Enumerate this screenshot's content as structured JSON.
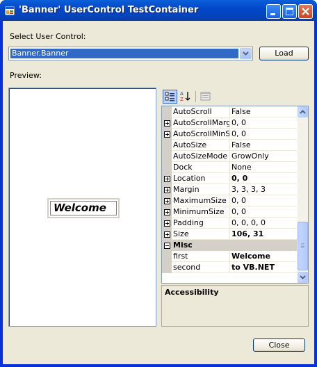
{
  "window": {
    "title": "'Banner' UserControl TestContainer"
  },
  "select_label": "Select User Control:",
  "combo_value": "Banner.Banner",
  "load_label": "Load",
  "preview_label": "Preview:",
  "banner_text": "Welcome",
  "propertygrid": {
    "rows": [
      {
        "name": "AutoScroll",
        "value": "False",
        "expandable": false,
        "bold": false
      },
      {
        "name": "AutoScrollMargin",
        "value": "0, 0",
        "expandable": true,
        "bold": false
      },
      {
        "name": "AutoScrollMinSize",
        "value": "0, 0",
        "expandable": true,
        "bold": false
      },
      {
        "name": "AutoSize",
        "value": "False",
        "expandable": false,
        "bold": false
      },
      {
        "name": "AutoSizeMode",
        "value": "GrowOnly",
        "expandable": false,
        "bold": false
      },
      {
        "name": "Dock",
        "value": "None",
        "expandable": false,
        "bold": false
      },
      {
        "name": "Location",
        "value": "0, 0",
        "expandable": true,
        "bold": true
      },
      {
        "name": "Margin",
        "value": "3, 3, 3, 3",
        "expandable": true,
        "bold": false
      },
      {
        "name": "MaximumSize",
        "value": "0, 0",
        "expandable": true,
        "bold": false
      },
      {
        "name": "MinimumSize",
        "value": "0, 0",
        "expandable": true,
        "bold": false
      },
      {
        "name": "Padding",
        "value": "0, 0, 0, 0",
        "expandable": true,
        "bold": false
      },
      {
        "name": "Size",
        "value": "106, 31",
        "expandable": true,
        "bold": true
      }
    ],
    "category": "Misc",
    "misc_rows": [
      {
        "name": "first",
        "value": "Welcome",
        "bold": true
      },
      {
        "name": "second",
        "value": "to VB.NET",
        "bold": true
      }
    ],
    "description_title": "Accessibility"
  },
  "close_label": "Close",
  "colors": {
    "title_bar": "#0347c9",
    "selection": "#316ac5",
    "client": "#ece9d8"
  }
}
